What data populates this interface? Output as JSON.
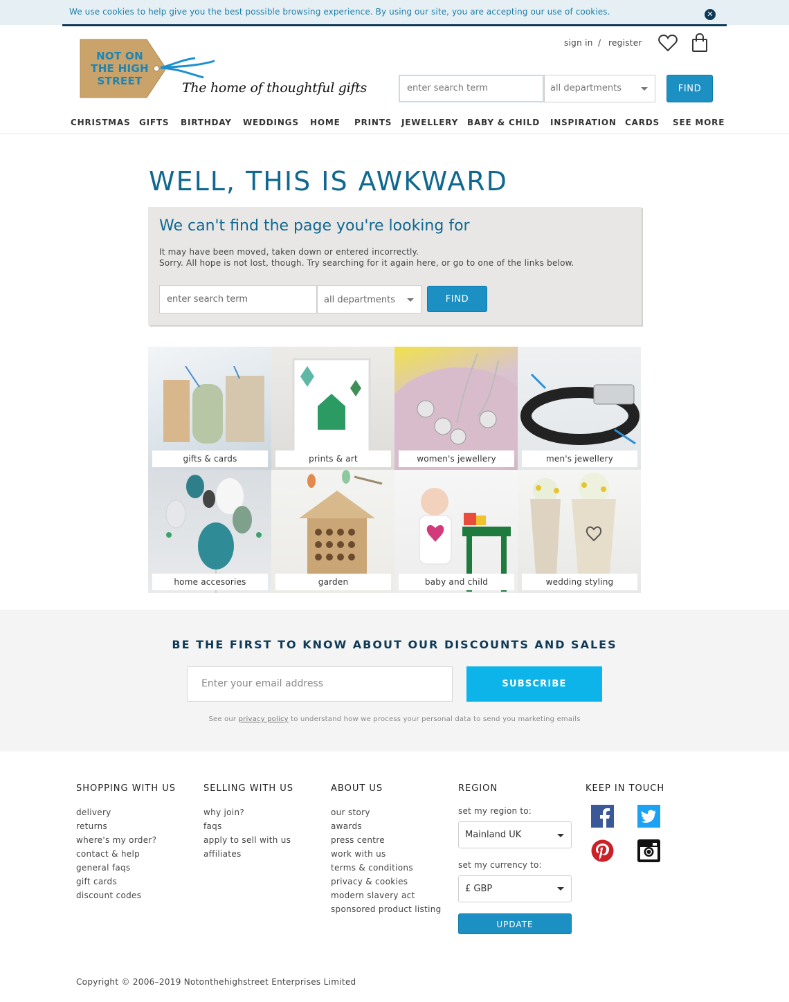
{
  "colors": {
    "brand_blue": "#1c8fc3",
    "heading_teal": "#10688f",
    "navy": "#0e3a57",
    "subscribe_cyan": "#0cb4ea",
    "panel_grey": "#e8e7e6"
  },
  "cookie_bar": {
    "text": "We use cookies to help give you the best possible browsing experience. By using our site, you are accepting our use of cookies.",
    "close_icon": "close-icon"
  },
  "header": {
    "logo_text": "NOT ON THE HIGH STREET",
    "tagline": "The home of thoughtful gifts",
    "sign_in": "sign in",
    "separator": "/",
    "register": "register",
    "wishlist_icon": "heart-icon",
    "basket_icon": "bag-icon",
    "search": {
      "placeholder": "enter search term",
      "department": "all departments",
      "button": "FIND"
    }
  },
  "nav": [
    "CHRISTMAS",
    "GIFTS",
    "BIRTHDAY",
    "WEDDINGS",
    "HOME",
    "PRINTS",
    "JEWELLERY",
    "BABY & CHILD",
    "INSPIRATION",
    "CARDS",
    "SEE MORE"
  ],
  "error_page": {
    "title": "WELL, THIS IS AWKWARD",
    "subtitle": "We can't find the page you're looking for",
    "line1": "It may have been moved, taken down or entered incorrectly.",
    "line2": "Sorry. All hope is not lost, though. Try searching for it again here, or go to one of the links below.",
    "search_placeholder": "enter search term",
    "department": "all departments",
    "button": "FIND"
  },
  "categories": [
    "gifts & cards",
    "prints & art",
    "women's jewellery",
    "men's jewellery",
    "home accesories",
    "garden",
    "baby and child",
    "wedding styling"
  ],
  "newsletter": {
    "title": "BE THE FIRST TO KNOW ABOUT OUR DISCOUNTS AND SALES",
    "placeholder": "Enter your email address",
    "button": "SUBSCRIBE",
    "note_before": "See our",
    "note_link": "privacy policy",
    "note_after": "to understand how we process your personal data to send you marketing emails"
  },
  "footer": {
    "shopping": {
      "title": "SHOPPING WITH US",
      "links": [
        "delivery",
        "returns",
        "where's my order?",
        "contact & help",
        "general faqs",
        "gift cards",
        "discount codes"
      ]
    },
    "selling": {
      "title": "SELLING WITH US",
      "links": [
        "why join?",
        "faqs",
        "apply to sell with us",
        "affiliates"
      ]
    },
    "about": {
      "title": "ABOUT US",
      "links": [
        "our story",
        "awards",
        "press centre",
        "work with us",
        "terms & conditions",
        "privacy & cookies",
        "modern slavery act",
        "sponsored product listing"
      ]
    },
    "region": {
      "title": "REGION",
      "region_label": "set my region to:",
      "region_value": "Mainland UK",
      "currency_label": "set my currency to:",
      "currency_value": "£ GBP",
      "button": "UPDATE"
    },
    "social": {
      "title": "KEEP IN TOUCH",
      "icons": [
        "facebook-icon",
        "twitter-icon",
        "pinterest-icon",
        "instagram-icon"
      ]
    },
    "copyright": "Copyright © 2006–2019 Notonthehighstreet Enterprises Limited"
  }
}
